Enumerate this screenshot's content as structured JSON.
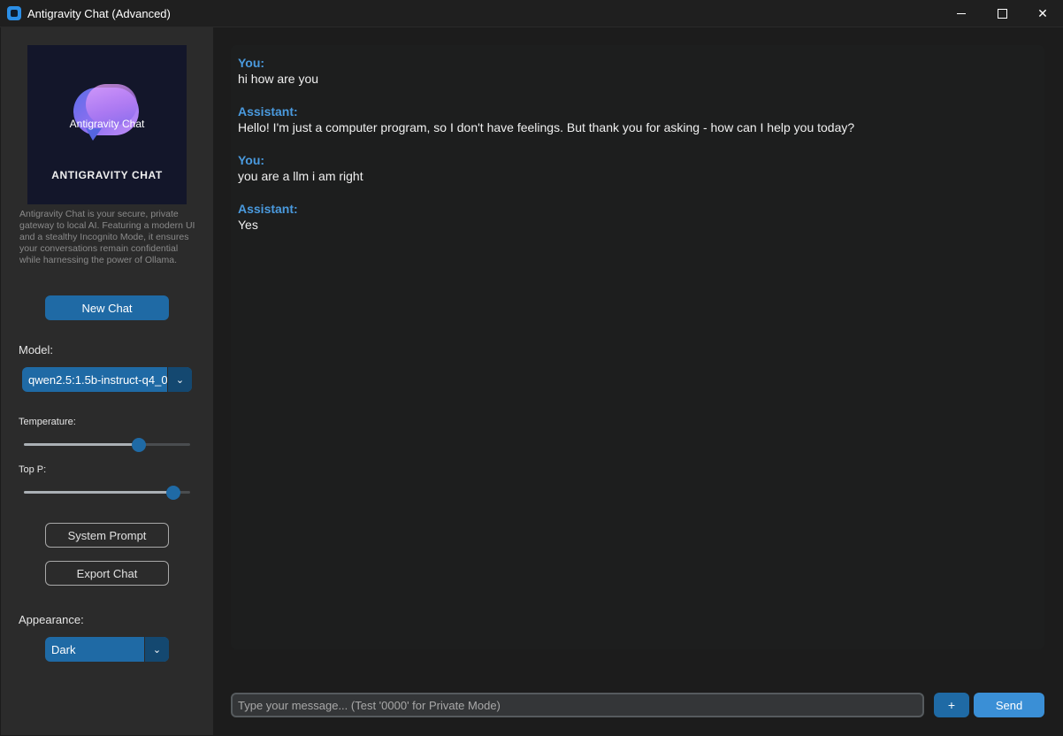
{
  "window": {
    "title": "Antigravity Chat (Advanced)",
    "minimize_icon": "minimize-icon",
    "maximize_icon": "maximize-icon",
    "close_icon": "close-icon",
    "close_glyph": "✕"
  },
  "sidebar": {
    "logo": {
      "caption": "Antigravity Chat",
      "wordmark": "ANTIGRAVITY CHAT"
    },
    "description": "Antigravity Chat is your secure, private gateway to local AI. Featuring a modern UI and a stealthy Incognito Mode, it ensures your conversations remain confidential while harnessing the power of Ollama.",
    "new_chat_label": "New Chat",
    "model_label": "Model:",
    "model_value": "qwen2.5:1.5b-instruct-q4_0",
    "temperature_label": "Temperature:",
    "temperature_level": 0.69,
    "top_p_label": "Top P:",
    "top_p_level": 0.9,
    "system_prompt_label": "System Prompt",
    "export_chat_label": "Export Chat",
    "appearance_label": "Appearance:",
    "appearance_value": "Dark",
    "dropdown_arrow_glyph": "⌄"
  },
  "chat": {
    "messages": [
      {
        "role": "You:",
        "text": "hi how are you"
      },
      {
        "role": "Assistant:",
        "text": "Hello! I'm just a computer program, so I don't have feelings. But thank you for asking - how can I help you today?"
      },
      {
        "role": "You:",
        "text": "you are a llm i am right"
      },
      {
        "role": "Assistant:",
        "text": "Yes"
      }
    ]
  },
  "input": {
    "placeholder": "Type your message... (Test '0000' for Private Mode)",
    "value": "",
    "add_label": "+",
    "send_label": "Send"
  },
  "colors": {
    "accent": "#1f6aa5",
    "role_label": "#4a9ade",
    "sidebar_bg": "#2b2b2b",
    "chat_bg": "#1d1e1e"
  }
}
